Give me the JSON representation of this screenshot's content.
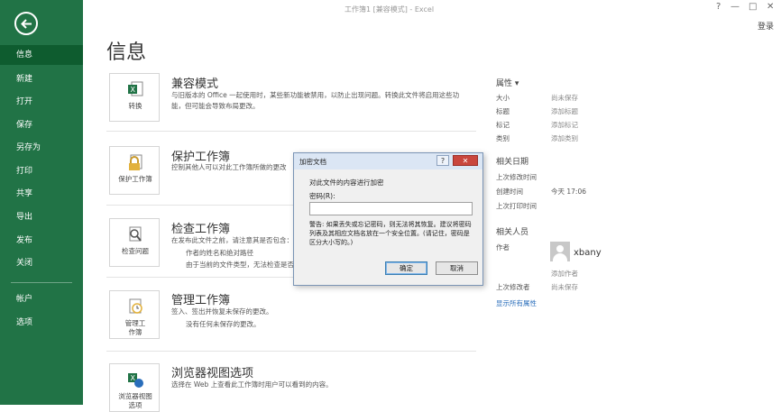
{
  "window": {
    "title": "工作簿1 [兼容模式] - Excel",
    "help": "?",
    "minimize": "—",
    "restore": "□",
    "close": "✕",
    "signin": "登录"
  },
  "sidebar": {
    "items": [
      {
        "label": "信息"
      },
      {
        "label": "新建"
      },
      {
        "label": "打开"
      },
      {
        "label": "保存"
      },
      {
        "label": "另存为"
      },
      {
        "label": "打印"
      },
      {
        "label": "共享"
      },
      {
        "label": "导出"
      },
      {
        "label": "发布"
      },
      {
        "label": "关闭"
      },
      {
        "label": "帐户"
      },
      {
        "label": "选项"
      }
    ]
  },
  "page_title": "信息",
  "sections": {
    "compat": {
      "button": "转换",
      "title": "兼容模式",
      "desc": "与旧版本的 Office 一起使用时，某些新功能被禁用，以防止出现问题。转换此文件将启用这些功能，但可能会导致布局更改。"
    },
    "protect": {
      "button": "保护工作簿",
      "title": "保护工作簿",
      "desc": "控制其他人可以对此工作簿所做的更改"
    },
    "inspect": {
      "button": "检查问题",
      "title": "检查工作簿",
      "desc": "在发布此文件之前，请注意其是否包含：",
      "bullet1": "作者的姓名和绝对路径",
      "bullet2": "由于当前的文件类型，无法检查是否"
    },
    "manage": {
      "button_line1": "管理工",
      "button_line2": "作簿",
      "title": "管理工作簿",
      "desc": "签入、签出并恢复未保存的更改。",
      "bullet": "没有任何未保存的更改。"
    },
    "browser": {
      "button_line1": "浏览器视图",
      "button_line2": "选项",
      "title": "浏览器视图选项",
      "desc": "选择在 Web 上查看此工作簿时用户可以看到的内容。"
    }
  },
  "properties": {
    "header": "属性",
    "rows": [
      {
        "label": "大小",
        "value": "尚未保存"
      },
      {
        "label": "标题",
        "value": "添加标题"
      },
      {
        "label": "标记",
        "value": "添加标记"
      },
      {
        "label": "类别",
        "value": "添加类别"
      }
    ],
    "dates_header": "相关日期",
    "dates": [
      {
        "label": "上次修改时间",
        "value": ""
      },
      {
        "label": "创建时间",
        "value": "今天 17:06"
      },
      {
        "label": "上次打印时间",
        "value": ""
      }
    ],
    "people_header": "相关人员",
    "author_label": "作者",
    "author_name": "xbany",
    "add_author": "添加作者",
    "last_modified_by_label": "上次修改者",
    "last_modified_by_value": "尚未保存",
    "show_all": "显示所有属性"
  },
  "dialog": {
    "title": "加密文档",
    "help": "?",
    "close": "✕",
    "prompt": "对此文件的内容进行加密",
    "password_label": "密码(R):",
    "password_value": "",
    "warning": "警告: 如果丢失或忘记密码，则无法将其恢复。建议将密码列表及其相应文档名放在一个安全位置。(请记住，密码是区分大小写的。)",
    "ok": "确定",
    "cancel": "取消"
  },
  "colors": {
    "sidebar": "#217346",
    "sidebar_active": "#0e5c2f",
    "dialog_titlebar": "#dbe6f4",
    "dialog_close": "#c9463d",
    "link": "#2a6ebb"
  }
}
